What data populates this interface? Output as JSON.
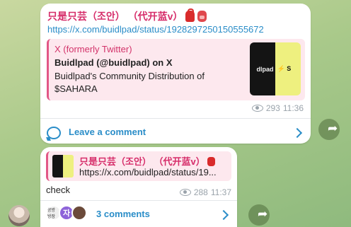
{
  "post1": {
    "title": "只是只芸（조안） （代开蓝v）",
    "link": "https://x.com/buidlpad/status/1928297250150555672",
    "preview": {
      "site": "X (formerly Twitter)",
      "title": "Buidlpad (@buidlpad) on X",
      "description": "Buidlpad's Community Distribution of $SAHARA",
      "thumb_left": "dlpad",
      "thumb_right": "⚡ S"
    },
    "views": "293",
    "time": "11:36",
    "comment_label": "Leave a comment"
  },
  "post2": {
    "quote_title": "只是只芸（조안） （代开蓝v）",
    "quote_link": "https://x.com/buidlpad/status/19...",
    "text": "check",
    "views": "288",
    "time": "11:37",
    "comments_label": "3 comments",
    "avatar2_letter": "자",
    "avatar1_text": "공방 방장"
  },
  "colors": {
    "accent": "#2a8dc8",
    "title_pink": "#d62d6a",
    "quote_bg": "#fde8ee"
  }
}
